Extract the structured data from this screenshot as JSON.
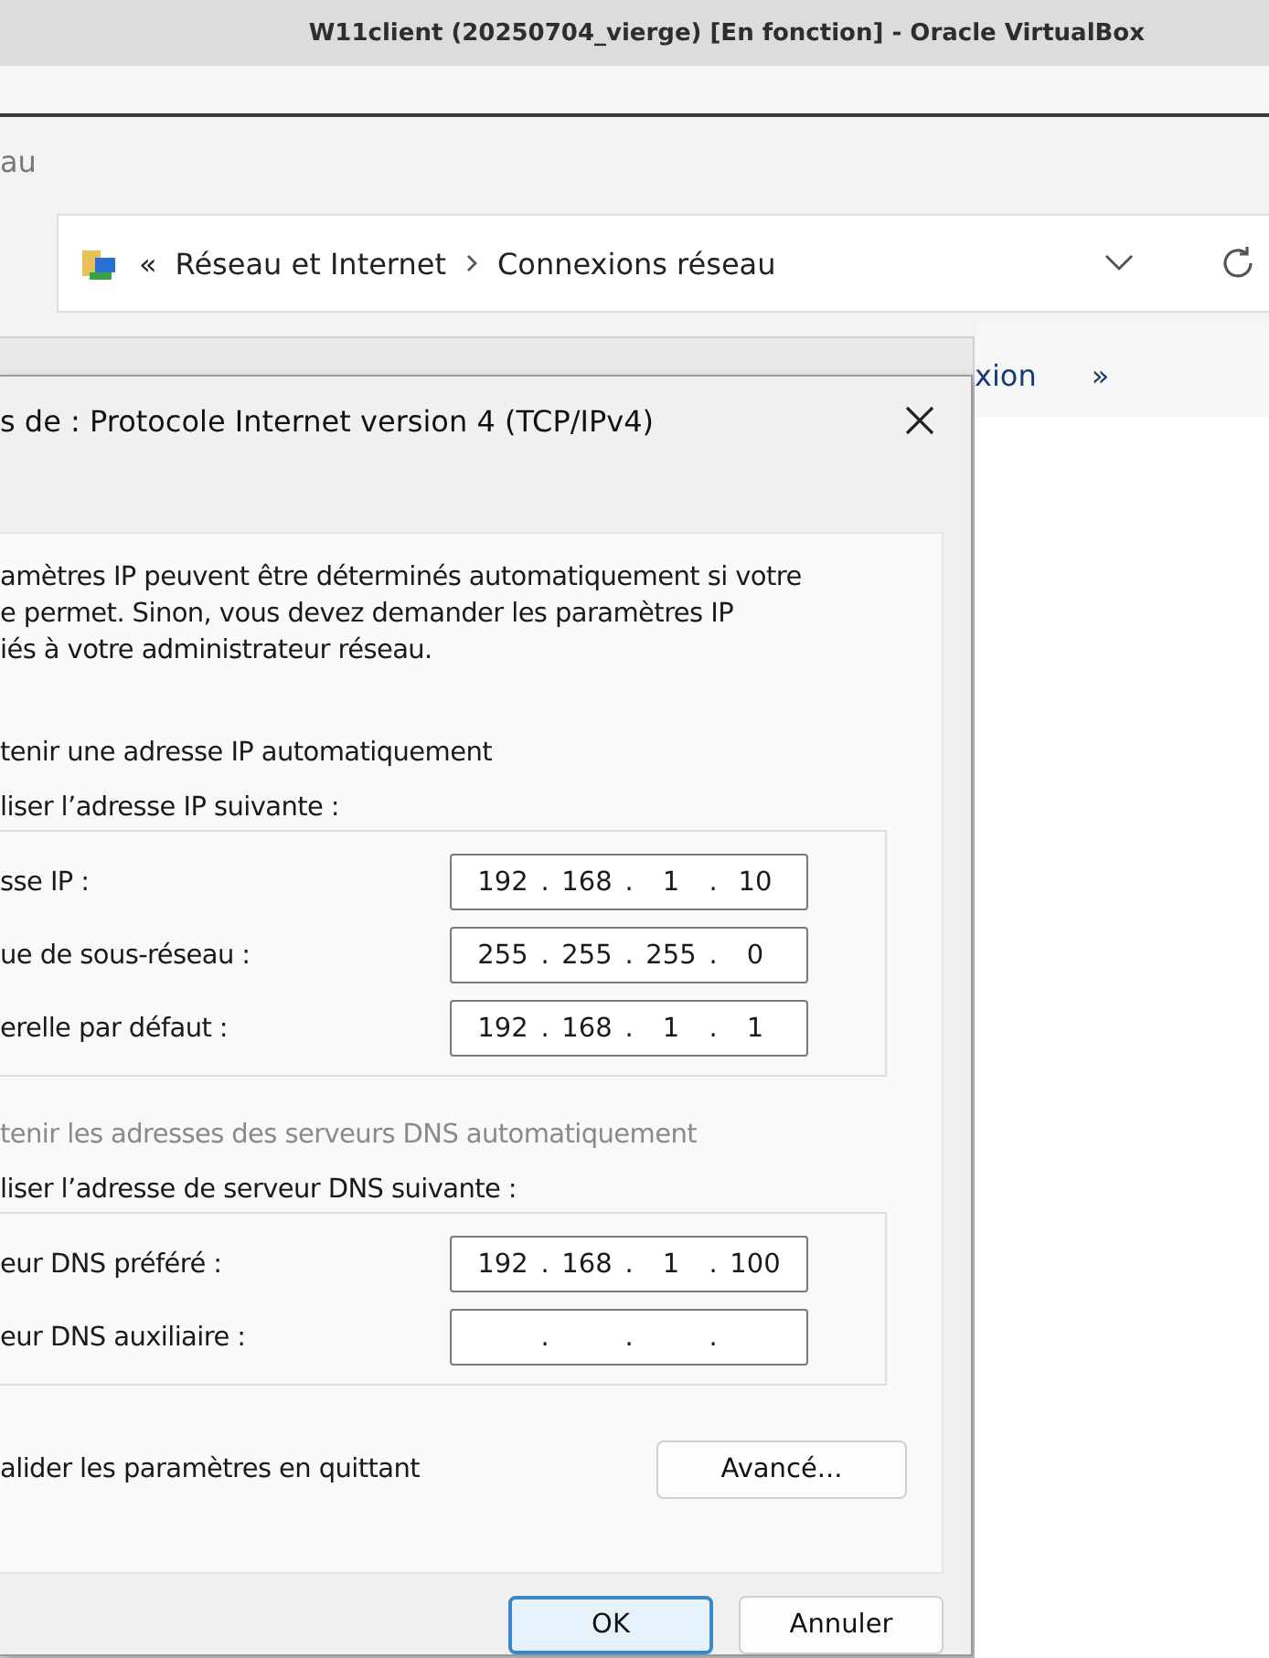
{
  "vm_window": {
    "title": "W11client (20250704_vierge) [En fonction] - Oracle VirtualBox"
  },
  "explorer": {
    "header_fragment": "au",
    "breadcrumb": {
      "prefix": "«",
      "items": [
        "Réseau et Internet",
        "Connexions réseau"
      ]
    },
    "toolbar_fragment": "xion",
    "more": "»"
  },
  "dialog": {
    "title": "s de : Protocole Internet version 4 (TCP/IPv4)",
    "intro": "amètres IP peuvent être déterminés automatiquement si votre\ne permet. Sinon, vous devez demander les paramètres IP\niés à votre administrateur réseau.",
    "separator": ".",
    "groups": [
      {
        "auto_option": {
          "label": "tenir une adresse IP automatiquement",
          "disabled": false
        },
        "manual_option": {
          "label": "liser l’adresse IP suivante :"
        },
        "fields": [
          {
            "label": "sse IP :",
            "octets": [
              "192",
              "168",
              "1",
              "10"
            ]
          },
          {
            "label": "ue de sous-réseau :",
            "octets": [
              "255",
              "255",
              "255",
              "0"
            ]
          },
          {
            "label": "erelle par défaut :",
            "octets": [
              "192",
              "168",
              "1",
              "1"
            ]
          }
        ]
      },
      {
        "auto_option": {
          "label": "tenir les adresses des serveurs DNS automatiquement",
          "disabled": true
        },
        "manual_option": {
          "label": "liser l’adresse de serveur DNS suivante :"
        },
        "fields": [
          {
            "label": "eur DNS préféré :",
            "octets": [
              "192",
              "168",
              "1",
              "100"
            ]
          },
          {
            "label": "eur DNS auxiliaire :"
          }
        ]
      }
    ],
    "validate_label": "alider les paramètres en quittant",
    "advanced_button": "Avancé...",
    "buttons": [
      {
        "label": "OK",
        "default": true
      },
      {
        "label": "Annuler",
        "default": false
      }
    ]
  }
}
